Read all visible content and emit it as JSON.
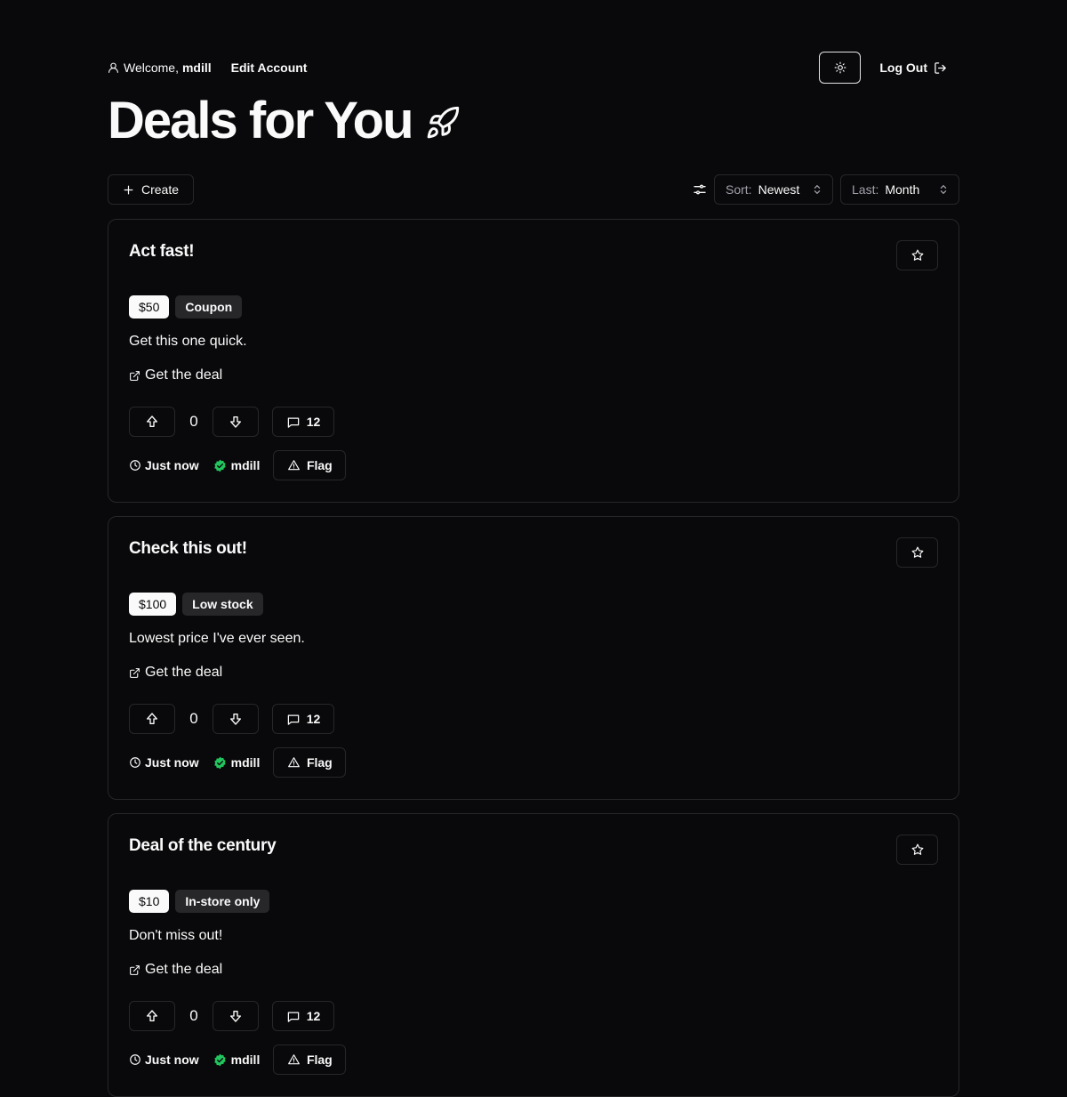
{
  "header": {
    "welcome_prefix": "Welcome,",
    "username": "mdill",
    "edit_account": "Edit Account",
    "logout": "Log Out",
    "theme_icon": "sun-icon"
  },
  "page": {
    "title": "Deals for You",
    "title_icon": "rocket-icon"
  },
  "toolbar": {
    "create_label": "Create",
    "filter_icon": "sliders-icon",
    "sort_label": "Sort:",
    "sort_value": "Newest",
    "last_label": "Last:",
    "last_value": "Month"
  },
  "deals": [
    {
      "title": "Act fast!",
      "price": "$50",
      "tag": "Coupon",
      "description": "Get this one quick.",
      "link_label": "Get the deal",
      "score": "0",
      "comments": "12",
      "time": "Just now",
      "author": "mdill",
      "flag_label": "Flag"
    },
    {
      "title": "Check this out!",
      "price": "$100",
      "tag": "Low stock",
      "description": "Lowest price I've ever seen.",
      "link_label": "Get the deal",
      "score": "0",
      "comments": "12",
      "time": "Just now",
      "author": "mdill",
      "flag_label": "Flag"
    },
    {
      "title": "Deal of the century",
      "price": "$10",
      "tag": "In-store only",
      "description": "Don't miss out!",
      "link_label": "Get the deal",
      "score": "0",
      "comments": "12",
      "time": "Just now",
      "author": "mdill",
      "flag_label": "Flag"
    }
  ],
  "colors": {
    "background": "#09090b",
    "foreground": "#fafafa",
    "border": "#27272a",
    "muted": "#a1a1aa",
    "verified": "#22c55e"
  }
}
